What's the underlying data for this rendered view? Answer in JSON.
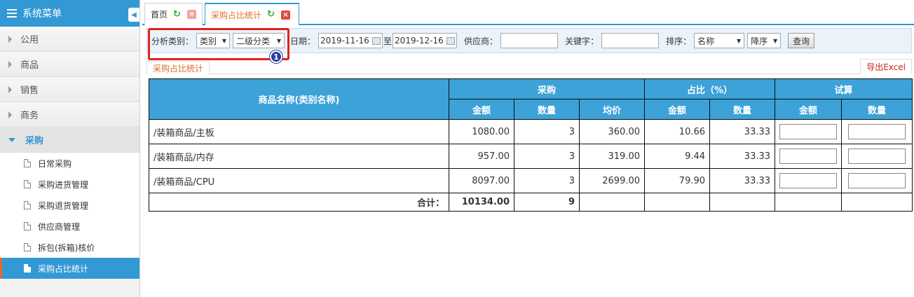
{
  "sidebar": {
    "title": "系统菜单",
    "collapse_glyph": "◀",
    "groups": [
      {
        "label": "公用"
      },
      {
        "label": "商品"
      },
      {
        "label": "销售"
      },
      {
        "label": "商务"
      },
      {
        "label": "采购"
      }
    ],
    "sub_items": [
      {
        "label": "日常采购"
      },
      {
        "label": "采购进货管理"
      },
      {
        "label": "采购退货管理"
      },
      {
        "label": "供应商管理"
      },
      {
        "label": "拆包(拆箱)核价"
      },
      {
        "label": "采购占比统计"
      }
    ],
    "accent_color": "#3399d5"
  },
  "tabs": [
    {
      "label": "首页"
    },
    {
      "label": "采购占比统计"
    }
  ],
  "icons": {
    "refresh": "↻",
    "close": "×"
  },
  "filters": {
    "analysis_type_label": "分析类别：",
    "type_value": "类别",
    "level_value": "二级分类",
    "date_label": "日期：",
    "date_start": "2019-11-16",
    "date_sep": "至",
    "date_end": "2019-12-16",
    "supplier_label": "供应商：",
    "supplier_value": "",
    "keyword_label": "关键字：",
    "keyword_value": "",
    "sort_label": "排序：",
    "sort_field": "名称",
    "sort_order": "降序",
    "query_button": "查询"
  },
  "annotation": {
    "badge": "1"
  },
  "subtab": {
    "label": "采购占比统计",
    "export": "导出Excel"
  },
  "table": {
    "header": {
      "name": "商品名称(类别名称)",
      "purchase": "采购",
      "ratio": "占比（%）",
      "trial": "试算",
      "amount": "金额",
      "qty": "数量",
      "avg_price": "均价",
      "ratio_amount": "金额",
      "ratio_qty": "数量",
      "trial_amount": "金额",
      "trial_qty": "数量"
    },
    "rows": [
      {
        "name": "/装箱商品/主板",
        "amount": "1080.00",
        "qty": "3",
        "avg": "360.00",
        "ratio_amount": "10.66",
        "ratio_qty": "33.33"
      },
      {
        "name": "/装箱商品/内存",
        "amount": "957.00",
        "qty": "3",
        "avg": "319.00",
        "ratio_amount": "9.44",
        "ratio_qty": "33.33"
      },
      {
        "name": "/装箱商品/CPU",
        "amount": "8097.00",
        "qty": "3",
        "avg": "2699.00",
        "ratio_amount": "79.90",
        "ratio_qty": "33.33"
      }
    ],
    "total": {
      "label": "合计：",
      "amount": "10134.00",
      "qty": "9"
    }
  }
}
